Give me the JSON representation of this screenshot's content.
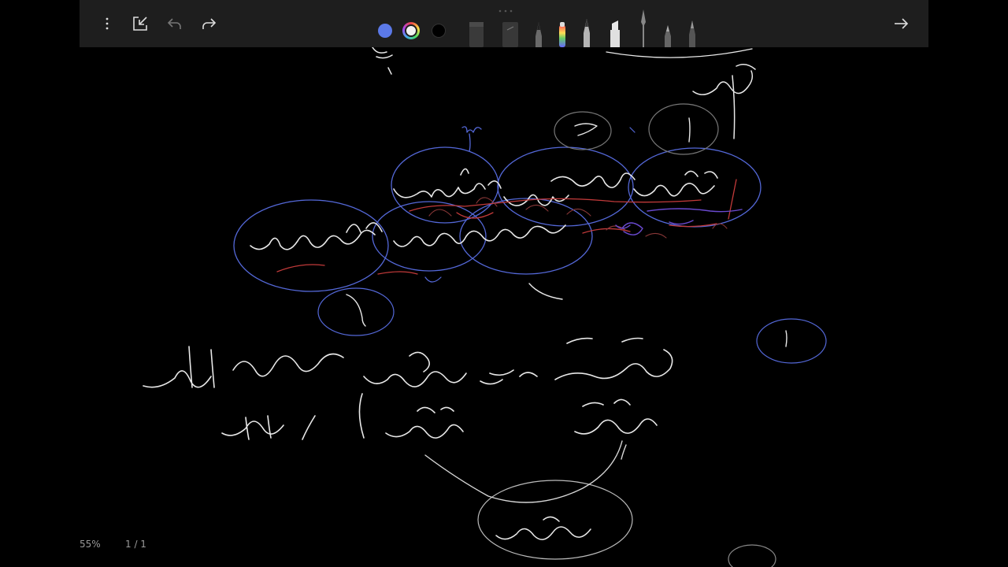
{
  "toolbar": {
    "colors": {
      "blue": "#5b79e8",
      "white": "#f2f2f2",
      "black": "#000000"
    },
    "icons": [
      "more-vertical-icon",
      "shrink-icon",
      "undo-icon",
      "redo-icon",
      "arrow-right-icon"
    ]
  },
  "status": {
    "zoom": "55%",
    "page": "1 / 1"
  }
}
